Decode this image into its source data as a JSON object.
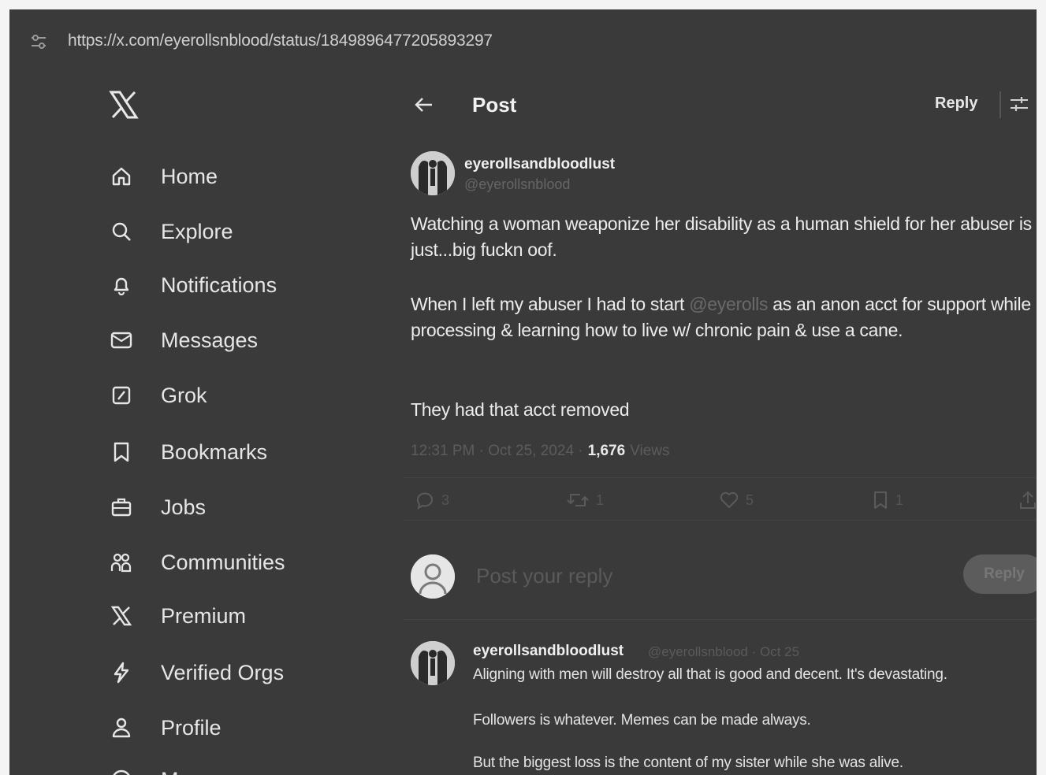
{
  "browser": {
    "url": "https://x.com/eyerollsnblood/status/1849896477205893297"
  },
  "sidebar": {
    "logo": "x-logo-icon",
    "items": [
      {
        "label": "Home",
        "icon": "home-icon"
      },
      {
        "label": "Explore",
        "icon": "search-icon"
      },
      {
        "label": "Notifications",
        "icon": "bell-icon"
      },
      {
        "label": "Messages",
        "icon": "mail-icon"
      },
      {
        "label": "Grok",
        "icon": "grok-icon"
      },
      {
        "label": "Bookmarks",
        "icon": "bookmark-icon"
      },
      {
        "label": "Jobs",
        "icon": "briefcase-icon"
      },
      {
        "label": "Communities",
        "icon": "communities-icon"
      },
      {
        "label": "Premium",
        "icon": "x-logo-icon"
      },
      {
        "label": "Verified Orgs",
        "icon": "lightning-icon"
      },
      {
        "label": "Profile",
        "icon": "person-icon"
      },
      {
        "label": "More",
        "icon": "more-icon"
      }
    ]
  },
  "header": {
    "title": "Post",
    "reply_label": "Reply"
  },
  "post": {
    "author": "eyerollsandbloodlust",
    "handle": "@eyerollsnblood",
    "paragraph1": "Watching a woman weaponize her disability as a human shield for her abuser is just...big fuckn oof.",
    "paragraph2_before": "When I left my abuser I had to start ",
    "paragraph2_mention": "@eyerolls",
    "paragraph2_after": " as an anon acct for support while processing & learning how to live w/ chronic pain & use a cane.",
    "paragraph3": "They had that acct removed",
    "timestamp": "12:31 PM · Oct 25, 2024 ·",
    "views_count": "1,676",
    "views_label": "Views",
    "actions": {
      "reply_count": "3",
      "repost_count": "1",
      "like_count": "5",
      "bookmark_count": "1"
    }
  },
  "compose": {
    "placeholder": "Post your reply",
    "button_label": "Reply"
  },
  "reply": {
    "author": "eyerollsandbloodlust",
    "handle": "@eyerollsnblood · Oct 25",
    "line1": "Aligning with men will destroy all that is good and decent. It's devastating.",
    "line2": "Followers is whatever. Memes can be made always.",
    "line3": "But the biggest loss is the content of my sister while she was alive."
  }
}
